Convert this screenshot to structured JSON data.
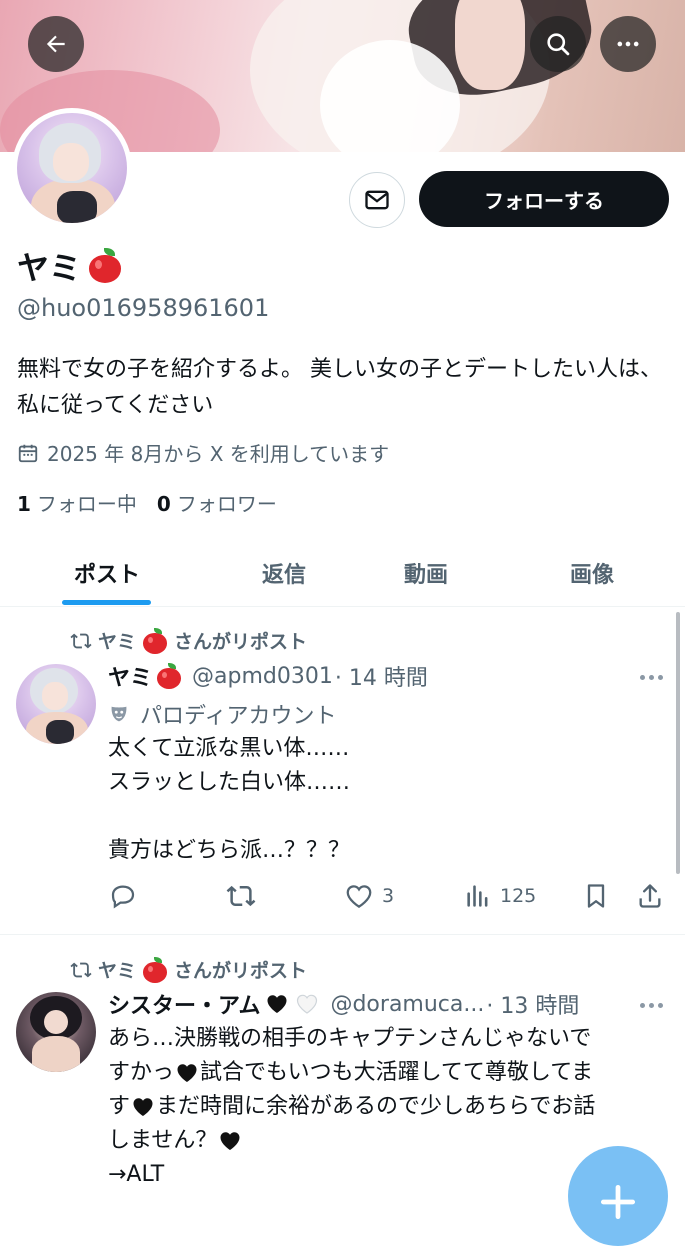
{
  "profile": {
    "name": "ヤミ",
    "handle": "@huo016958961601",
    "bio": "無料で女の子を紹介するよ。 美しい女の子とデートしたい人は、私に従ってください",
    "joined": "2025 年 8月から X を利用しています",
    "following_count": "1",
    "following_label": "フォロー中",
    "followers_count": "0",
    "followers_label": "フォロワー",
    "follow_button": "フォローする"
  },
  "header": {
    "back_icon": "arrow-left-icon",
    "search_icon": "search-icon",
    "more_icon": "more-horizontal-icon"
  },
  "tabs": [
    {
      "label": "ポスト",
      "active": true
    },
    {
      "label": "返信",
      "active": false
    },
    {
      "label": "動画",
      "active": false
    },
    {
      "label": "画像",
      "active": false
    }
  ],
  "posts": [
    {
      "repost_label": "ヤミ",
      "repost_suffix": "さんがリポスト",
      "author": "ヤミ",
      "handle": "@apmd0301",
      "time": "· 14 時間",
      "badge": "パロディアカウント",
      "text": "太くて立派な黒い体……\nスラッと­した白い体……\n\n貴方はどちら派…？？？",
      "likes": "3",
      "views": "125"
    },
    {
      "repost_label": "ヤミ",
      "repost_suffix": "さんがリポスト",
      "author": "シスター・アム",
      "handle": "@doramuca...",
      "time": "· 13 時間",
      "text_lines": [
        "あら…決勝戦の相手のキャプテンさんじゃないで",
        "すかっ",
        "試合でもいつも大活躍してて尊敬してま",
        "す",
        "まだ時間に余裕があるので少しあちらでお話",
        "しません？",
        "→ALT"
      ]
    }
  ],
  "colors": {
    "accent": "#1d9bf0",
    "text": "#0f1419",
    "secondary": "#536471",
    "follow_bg": "#0f1419"
  }
}
